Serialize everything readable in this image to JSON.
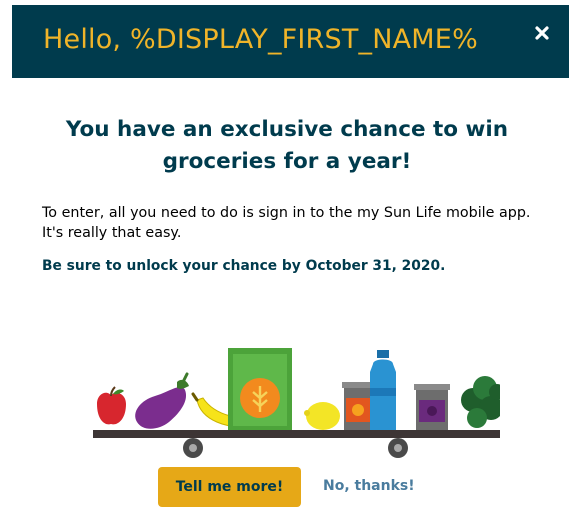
{
  "header": {
    "title": "Hello, %DISPLAY_FIRST_NAME%",
    "close_icon": "close-icon"
  },
  "content": {
    "headline": "You have an exclusive chance to win groceries for a year!",
    "body": "To enter, all you need to do is sign in to the my Sun Life mobile app. It's really that easy.",
    "deadline": "Be sure to unlock your chance by October 31, 2020."
  },
  "illustration": {
    "icons": [
      "apple-icon",
      "eggplant-icon",
      "banana-icon",
      "cereal-box-icon",
      "lemon-icon",
      "jar-icon",
      "water-bottle-icon",
      "can-icon",
      "kale-icon",
      "conveyor-belt-icon"
    ]
  },
  "actions": {
    "primary_label": "Tell me more!",
    "secondary_label": "No, thanks!"
  },
  "colors": {
    "header_bg": "#003b4d",
    "header_text": "#f0b429",
    "headline": "#003b4d",
    "button_bg": "#e6a817",
    "link": "#4a7c9e"
  }
}
